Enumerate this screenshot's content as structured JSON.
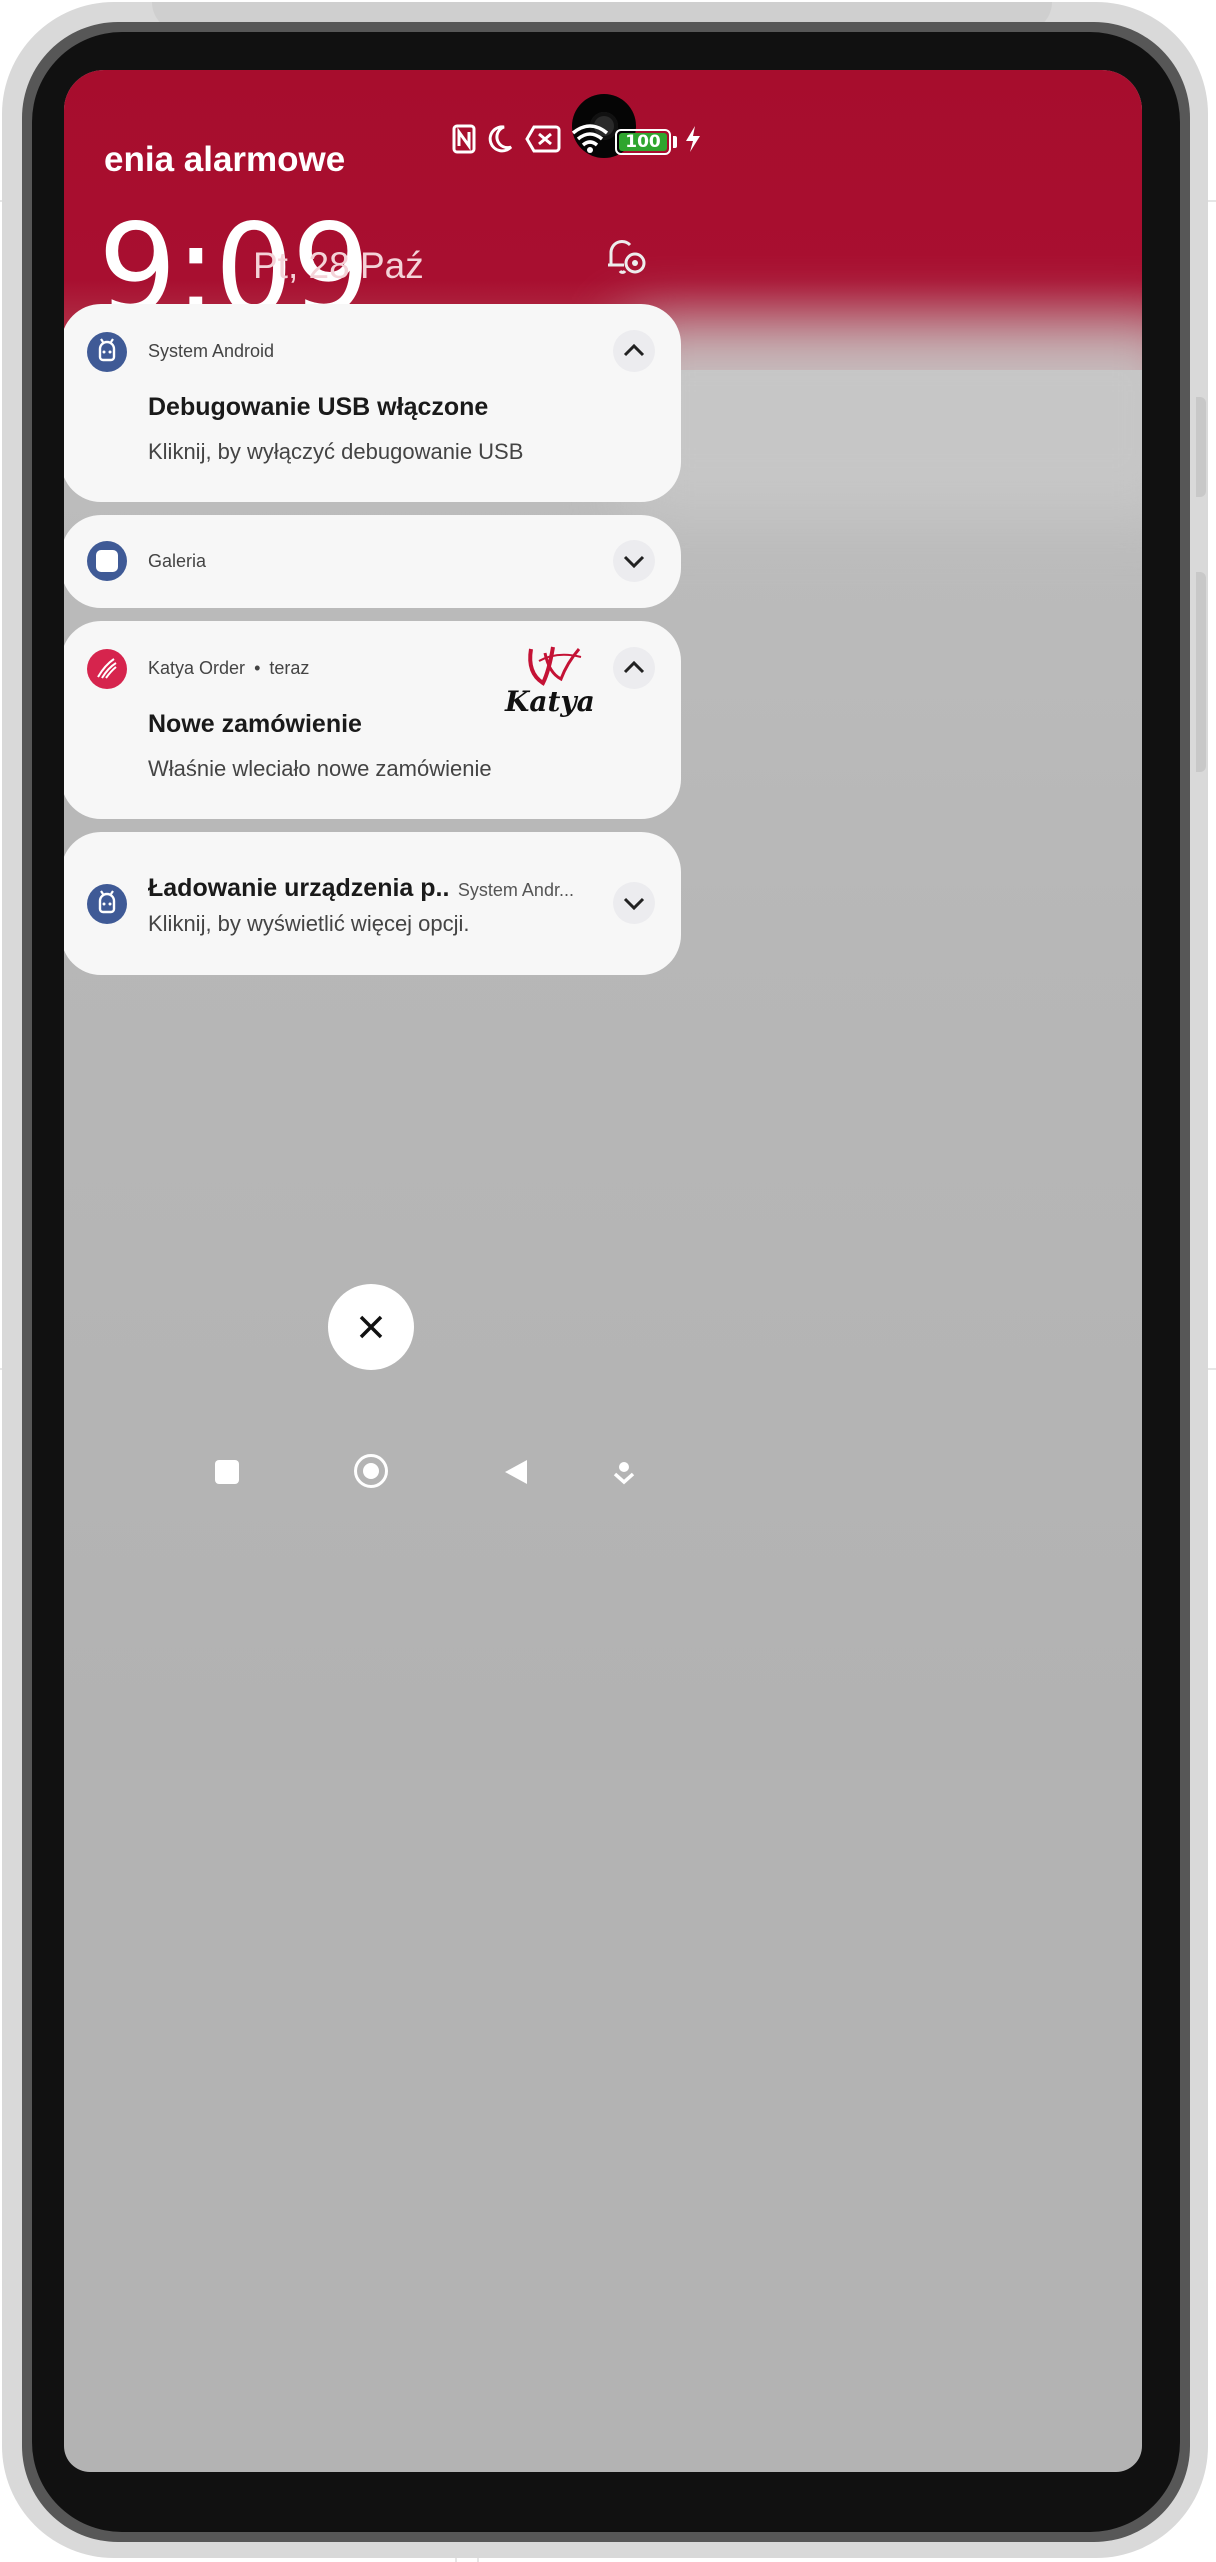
{
  "status_bar": {
    "carrier_text": "enia alarmowe",
    "battery_level": "100",
    "icons": [
      "nfc-icon",
      "do-not-disturb-moon-icon",
      "no-sim-icon",
      "wifi-icon",
      "battery-icon",
      "charging-bolt-icon"
    ]
  },
  "lock_header": {
    "time": "9:09",
    "date": "Pt, 28 Paź"
  },
  "notifications": [
    {
      "app": "System Android",
      "title": "Debugowanie USB włączone",
      "text": "Kliknij, by wyłączyć debugowanie USB",
      "expanded": true
    },
    {
      "app": "Galeria",
      "expanded": false
    },
    {
      "app": "Katya Order",
      "time": "teraz",
      "title": "Nowe zamówienie",
      "text": "Właśnie wleciało nowe zamówienie",
      "logo_text": "Katya",
      "expanded": true
    },
    {
      "title": "Ładowanie urządzenia p..",
      "app": "System Andr...",
      "text": "Kliknij, by wyświetlić więcej opcji.",
      "expanded": false
    }
  ],
  "actions": {
    "close_all": "close-icon"
  },
  "nav_bar": [
    "recents-square-icon",
    "home-circle-icon",
    "back-triangle-icon",
    "drawer-down-icon"
  ],
  "colors": {
    "header_red": "#a70d2d",
    "android_blue": "#3f5a96",
    "katya_red": "#d6244d",
    "battery_green": "#2fa52e"
  },
  "separator": "•"
}
